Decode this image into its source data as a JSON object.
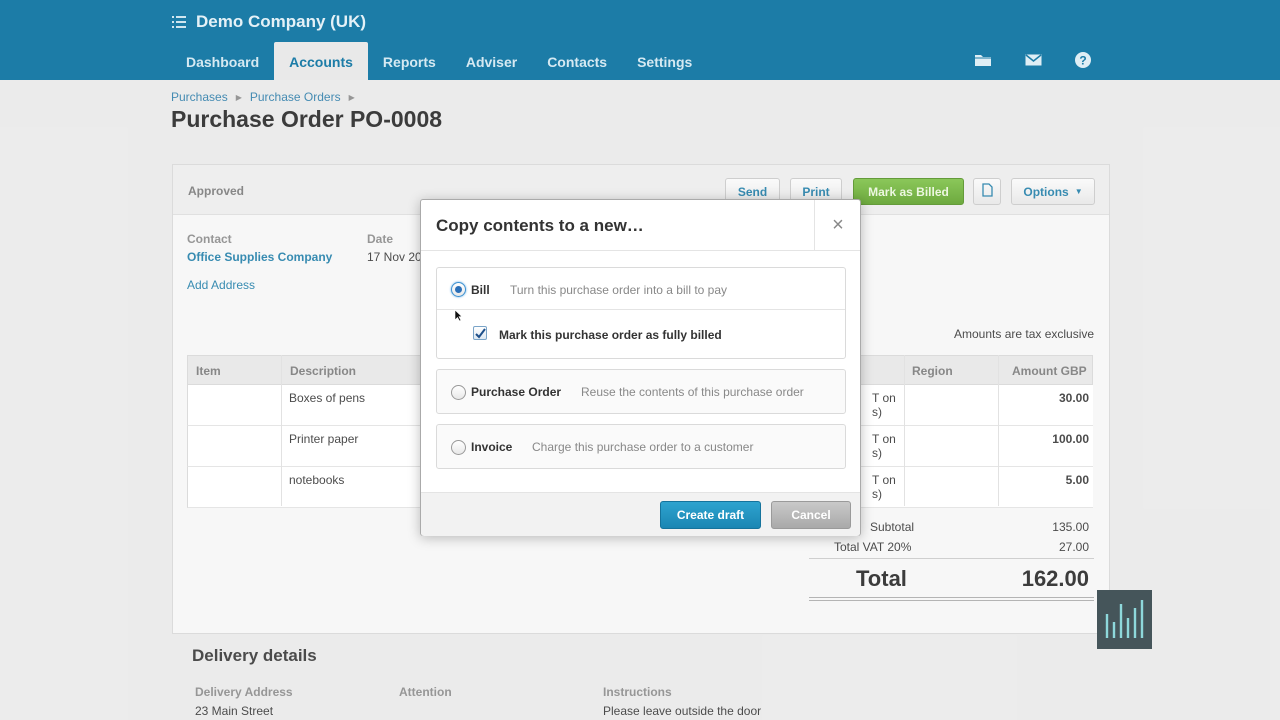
{
  "header": {
    "company": "Demo Company (UK)",
    "tabs": [
      {
        "label": "Dashboard"
      },
      {
        "label": "Accounts"
      },
      {
        "label": "Reports"
      },
      {
        "label": "Adviser"
      },
      {
        "label": "Contacts"
      },
      {
        "label": "Settings"
      }
    ],
    "active_tab": "Accounts",
    "icons": [
      "folder-icon",
      "mail-icon",
      "help-icon"
    ]
  },
  "breadcrumb": [
    "Purchases",
    "Purchase Orders"
  ],
  "page_title": "Purchase Order PO-0008",
  "toolbar": {
    "status": "Approved",
    "send": "Send",
    "print": "Print",
    "mark_billed": "Mark as Billed",
    "options": "Options"
  },
  "order": {
    "contact_label": "Contact",
    "contact": "Office Supplies Company",
    "date_label": "Date",
    "date": "17 Nov 20",
    "add_address": "Add Address",
    "tax_note": "Amounts are tax exclusive"
  },
  "table": {
    "headers": {
      "item": "Item",
      "description": "Description",
      "region": "Region",
      "amount": "Amount GBP"
    },
    "rows": [
      {
        "description": "Boxes of pens",
        "tax_partial_1": "T on",
        "tax_partial_2": "s)",
        "amount": "30.00"
      },
      {
        "description": "Printer paper",
        "tax_partial_1": "T on",
        "tax_partial_2": "s)",
        "amount": "100.00"
      },
      {
        "description": "notebooks",
        "tax_partial_1": "T on",
        "tax_partial_2": "s)",
        "amount": "5.00"
      }
    ]
  },
  "totals": {
    "subtotal_label": "Subtotal",
    "subtotal": "135.00",
    "vat_label": "Total VAT 20%",
    "vat": "27.00",
    "total_label": "Total",
    "total": "162.00"
  },
  "delivery": {
    "title": "Delivery details",
    "address_label": "Delivery Address",
    "address": "23 Main Street",
    "attention_label": "Attention",
    "instructions_label": "Instructions",
    "instructions": "Please leave outside the door"
  },
  "modal": {
    "title": "Copy contents to a new…",
    "close": "×",
    "options": [
      {
        "label": "Bill",
        "desc": "Turn this purchase order into a bill to pay",
        "selected": true
      },
      {
        "label": "Purchase Order",
        "desc": "Reuse the contents of this purchase order",
        "selected": false
      },
      {
        "label": "Invoice",
        "desc": "Charge this purchase order to a customer",
        "selected": false
      }
    ],
    "checkbox_label": "Mark this purchase order as fully billed",
    "checkbox_checked": true,
    "create": "Create draft",
    "cancel": "Cancel"
  },
  "colors": {
    "topbar": "#1c7ca7",
    "primary_button": "#1a86b3",
    "green_button": "#5a9e25"
  }
}
